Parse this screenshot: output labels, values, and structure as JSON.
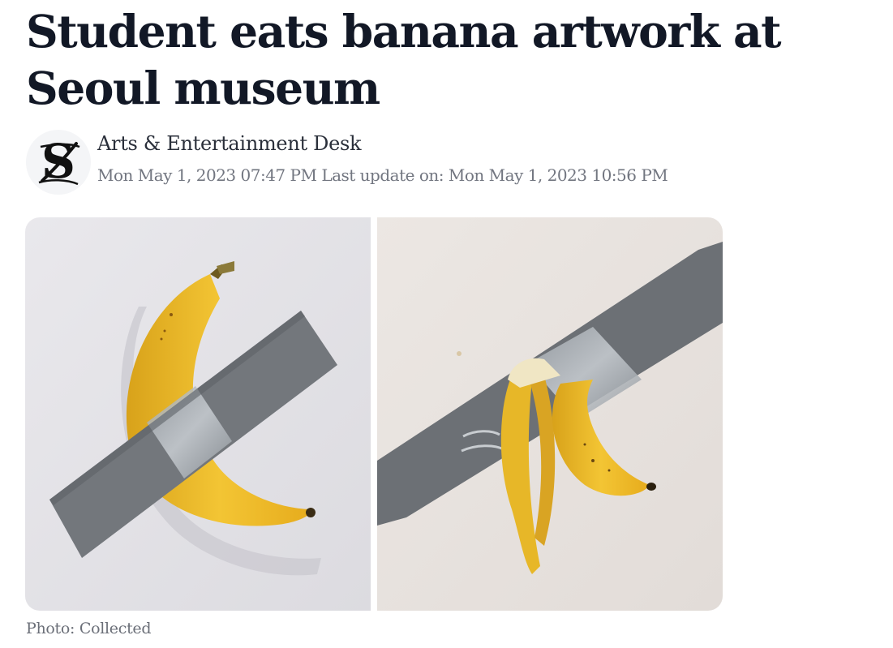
{
  "article": {
    "headline": "Student eats banana artwork at Seoul museum",
    "byline": {
      "author": "Arts & Entertainment Desk",
      "published": "Mon May 1, 2023 07:47 PM",
      "updated_prefix": "Last update on:",
      "updated": "Mon May 1, 2023 10:56 PM"
    },
    "logo_icon": "daily-star-s-logo-icon",
    "photo": {
      "left_panel": "banana-duct-taped-to-wall",
      "right_panel": "eaten-banana-peel-taped-to-wall",
      "caption": "Photo: Collected"
    }
  }
}
